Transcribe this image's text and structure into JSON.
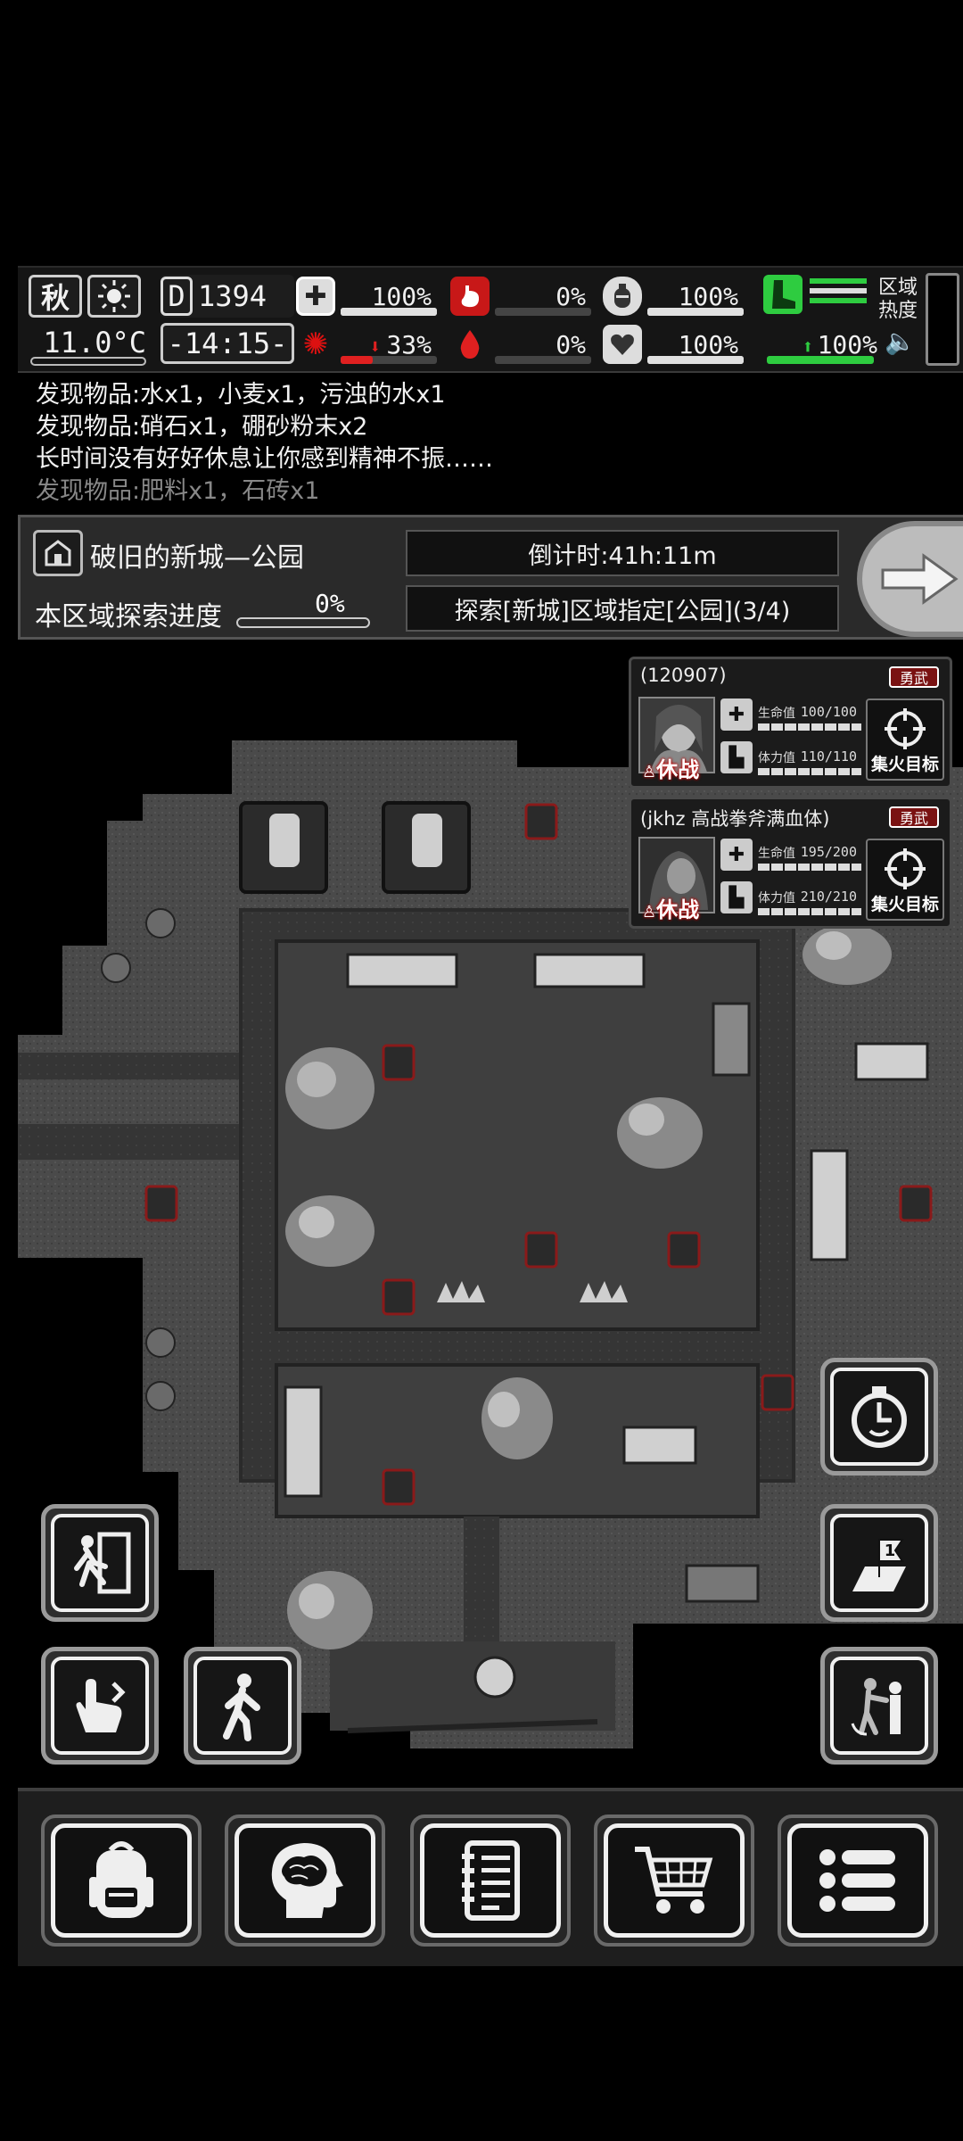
{
  "status": {
    "season": "秋",
    "weather_icon": "sun-icon",
    "temperature": "11.0°C",
    "day": "1394",
    "clock": "-14:15-",
    "stats": {
      "health": {
        "value": "100%",
        "icon": "medkit-icon",
        "fill": 1.0
      },
      "hunger": {
        "value": "0%",
        "icon": "stomach-icon",
        "fill": 0.0
      },
      "thirst_drink": {
        "value": "100%",
        "icon": "canteen-icon",
        "fill": 1.0
      },
      "infection": {
        "value": "33%",
        "icon": "virus-icon",
        "fill": 0.33
      },
      "bleeding": {
        "value": "0%",
        "icon": "blood-drop-icon",
        "fill": 0.0
      },
      "mood": {
        "value": "100%",
        "icon": "heart-icon",
        "fill": 1.0
      },
      "stamina": {
        "value": "100%",
        "icon": "boot-icon",
        "fill": 1.0
      }
    },
    "region_heat_label": "区域热度",
    "colors": {
      "accent_green": "#2ecc40",
      "danger_red": "#e02020"
    }
  },
  "log": [
    "发现物品:水x1，小麦x1，污浊的水x1",
    "发现物品:硝石x1，硼砂粉末x2",
    "长时间没有好好休息让你感到精神不振……",
    "发现物品:肥料x1，石砖x1"
  ],
  "location": {
    "name": "破旧的新城—公园",
    "explore_label": "本区域探索进度",
    "explore_pct": "0%",
    "countdown": "倒计时:41h:11m",
    "task": "探索[新城]区域指定[公园](3/4)"
  },
  "players": [
    {
      "name": "(120907)",
      "badge": "勇武",
      "truce": "休战",
      "hp_label": "生命值",
      "hp": "100/100",
      "sp_label": "体力值",
      "sp": "110/110",
      "target": "集火目标"
    },
    {
      "name": "(jkhz 高战拳斧满血体)",
      "badge": "勇武",
      "truce": "休战",
      "hp_label": "生命值",
      "hp": "195/200",
      "sp_label": "体力值",
      "sp": "210/210",
      "target": "集火目标"
    }
  ],
  "side_buttons": {
    "exit": "exit-icon",
    "tap": "tap-icon",
    "walk": "walk-icon",
    "timer": "stopwatch-icon",
    "map_marker": "1",
    "combat": "combat-stance-icon"
  },
  "nav": [
    "backpack-icon",
    "brain-icon",
    "notebook-icon",
    "cart-icon",
    "menu-icon"
  ]
}
